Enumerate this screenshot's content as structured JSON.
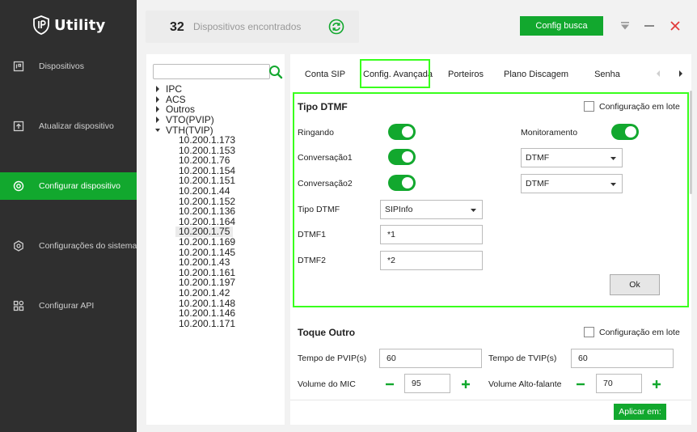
{
  "app": {
    "name": "Utility",
    "accent_color": "#12a82e",
    "highlight_color": "#39ff1d"
  },
  "sidebar": {
    "items": [
      {
        "label": "Dispositivos",
        "icon": "devices-icon",
        "active": false
      },
      {
        "label": "Atualizar dispositivo",
        "icon": "upload-icon",
        "active": false
      },
      {
        "label": "Configurar dispositivo",
        "icon": "target-icon",
        "active": true
      },
      {
        "label": "Configurações do sistema",
        "icon": "hex-gear-icon",
        "active": false
      },
      {
        "label": "Configurar API",
        "icon": "grid-icon",
        "active": false
      }
    ]
  },
  "topbar": {
    "device_count": "32",
    "count_label": "Dispositivos encontrados",
    "config_busca_label": "Config busca"
  },
  "tree": {
    "search_value": "",
    "categories": [
      {
        "label": "IPC",
        "expanded": false
      },
      {
        "label": "ACS",
        "expanded": false
      },
      {
        "label": "Outros",
        "expanded": false
      },
      {
        "label": "VTO(PVIP)",
        "expanded": false
      },
      {
        "label": "VTH(TVIP)",
        "expanded": true
      }
    ],
    "ips": [
      "10.200.1.173",
      "10.200.1.153",
      "10.200.1.76",
      "10.200.1.154",
      "10.200.1.151",
      "10.200.1.44",
      "10.200.1.152",
      "10.200.1.136",
      "10.200.1.164",
      "10.200.1.75",
      "10.200.1.169",
      "10.200.1.145",
      "10.200.1.43",
      "10.200.1.161",
      "10.200.1.197",
      "10.200.1.42",
      "10.200.1.148",
      "10.200.1.146",
      "10.200.1.171"
    ],
    "selected_ip": "10.200.1.75"
  },
  "tabs": {
    "items": [
      "Conta SIP",
      "Config. Avançada",
      "Porteiros",
      "Plano Discagem",
      "Senha"
    ],
    "active": "Config. Avançada"
  },
  "dtmf": {
    "title": "Tipo DTMF",
    "batch_label": "Configuração em lote",
    "batch_checked": false,
    "ringing_label": "Ringando",
    "ringing_on": true,
    "monitoring_label": "Monitoramento",
    "monitoring_on": true,
    "conv1_label": "Conversação1",
    "conv1_on": true,
    "conv1_select": "DTMF",
    "conv2_label": "Conversação2",
    "conv2_on": true,
    "conv2_select": "DTMF",
    "type_label": "Tipo DTMF",
    "type_select": "SIPInfo",
    "dtmf1_label": "DTMF1",
    "dtmf1_value": "*1",
    "dtmf2_label": "DTMF2",
    "dtmf2_value": "*2",
    "ok_label": "Ok"
  },
  "toque": {
    "title": "Toque Outro",
    "batch_label": "Configuração em lote",
    "batch_checked": false,
    "pvip_label": "Tempo de PVIP(s)",
    "pvip_value": "60",
    "tvip_label": "Tempo de TVIP(s)",
    "tvip_value": "60",
    "mic_label": "Volume do MIC",
    "mic_value": "95",
    "speaker_label": "Volume Alto-falante",
    "speaker_value": "70",
    "apply_label": "Aplicar em:"
  }
}
